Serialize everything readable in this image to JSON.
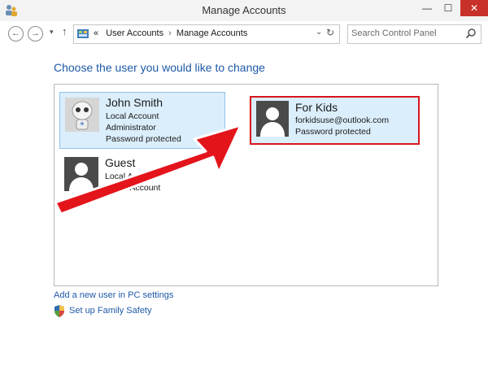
{
  "window": {
    "title": "Manage Accounts",
    "minimize_glyph": "—",
    "maximize_glyph": "☐",
    "close_glyph": "✕",
    "app_icon": "users-control-panel-icon"
  },
  "nav": {
    "back_glyph": "←",
    "forward_glyph": "→",
    "recent_glyph": "▾",
    "up_glyph": "↑"
  },
  "address": {
    "prefix": "«",
    "crumbs": [
      "User Accounts",
      "Manage Accounts"
    ],
    "separator": "›",
    "dropdown_glyph": "⌄",
    "refresh_glyph": "↻"
  },
  "search": {
    "placeholder": "Search Control Panel"
  },
  "heading": "Choose the user you would like to change",
  "accounts": [
    {
      "name": "John Smith",
      "lines": [
        "Local Account",
        "Administrator",
        "Password protected"
      ],
      "avatar": "robot-avatar-icon",
      "selected": true
    },
    {
      "name": "For Kids",
      "lines": [
        "forkidsuse@outlook.com",
        "Password protected"
      ],
      "avatar": "generic-user-avatar-icon",
      "highlighted": true,
      "highlight_color": "#d9151f"
    },
    {
      "name": "Guest",
      "lines": [
        "Local Account",
        "Guest Account"
      ],
      "avatar": "generic-user-avatar-icon"
    }
  ],
  "links": {
    "add_user": "Add a new user in PC settings",
    "family_safety": "Set up Family Safety"
  },
  "colors": {
    "link": "#1e5aa8",
    "selection_fill": "#dbeefb",
    "annotation_red": "#e4141b",
    "close_button": "#c7312a"
  }
}
